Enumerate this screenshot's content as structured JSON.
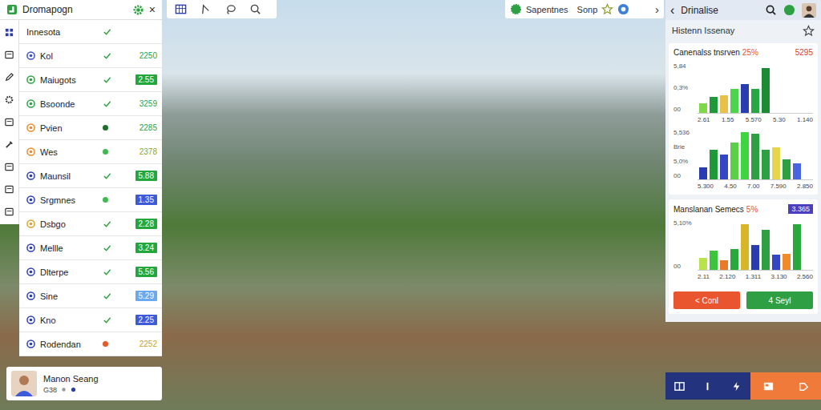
{
  "left_panel": {
    "title": "Dromapogn",
    "close": "×",
    "items": [
      {
        "name": "Innesota",
        "icon_color": null,
        "mark": "check",
        "mark_color": "#2ea043",
        "value": null,
        "value_style": "none",
        "value_color": null
      },
      {
        "name": "Kol",
        "icon_color": "#3a4fc8",
        "mark": "check",
        "mark_color": "#2ea043",
        "value": "2250",
        "value_style": "plain",
        "value_color": "#2ea043"
      },
      {
        "name": "Maiugots",
        "icon_color": "#2ea043",
        "mark": "check",
        "mark_color": "#2ea043",
        "value": "2.55",
        "value_style": "filled",
        "value_color": "#22a83a"
      },
      {
        "name": "Bsoonde",
        "icon_color": "#2ea043",
        "mark": "check",
        "mark_color": "#2ea043",
        "value": "3259",
        "value_style": "plain",
        "value_color": "#2ea043"
      },
      {
        "name": "Pvien",
        "icon_color": "#e8892a",
        "mark": "dot",
        "mark_color": "#1e6e2c",
        "value": "2285",
        "value_style": "plain",
        "value_color": "#2ea043"
      },
      {
        "name": "Wes",
        "icon_color": "#e8892a",
        "mark": "dot",
        "mark_color": "#3fb950",
        "value": "2378",
        "value_style": "plain",
        "value_color": "#8aa62a"
      },
      {
        "name": "Maunsil",
        "icon_color": "#2a3db0",
        "mark": "check",
        "mark_color": "#2ea043",
        "value": "5.88",
        "value_style": "filled",
        "value_color": "#22a83a"
      },
      {
        "name": "Srgmnes",
        "icon_color": "#2a3db0",
        "mark": "dot",
        "mark_color": "#3fb950",
        "value": "1.35",
        "value_style": "filled",
        "value_color": "#3d5bd9"
      },
      {
        "name": "Dsbgo",
        "icon_color": "#d9a12a",
        "mark": "check",
        "mark_color": "#2ea043",
        "value": "2.28",
        "value_style": "filled",
        "value_color": "#22a83a"
      },
      {
        "name": "Mellle",
        "icon_color": "#2a3db0",
        "mark": "check",
        "mark_color": "#2ea043",
        "value": "3.24",
        "value_style": "filled",
        "value_color": "#22a83a"
      },
      {
        "name": "Dlterpe",
        "icon_color": "#2a3db0",
        "mark": "check",
        "mark_color": "#2ea043",
        "value": "5.56",
        "value_style": "filled",
        "value_color": "#22a83a"
      },
      {
        "name": "Sine",
        "icon_color": "#2a3db0",
        "mark": "check",
        "mark_color": "#2ea043",
        "value": "5.29",
        "value_style": "filled",
        "value_color": "#6aa8f0"
      },
      {
        "name": "Kno",
        "icon_color": "#2a3db0",
        "mark": "check",
        "mark_color": "#2ea043",
        "value": "2.25",
        "value_style": "filled",
        "value_color": "#3d5bd9"
      },
      {
        "name": "Rodendan",
        "icon_color": "#2a3db0",
        "mark": "dot",
        "mark_color": "#e05a2a",
        "value": "2252",
        "value_style": "plain",
        "value_color": "#c9a22a"
      }
    ]
  },
  "user_card": {
    "name": "Manon Seang",
    "subtitle": "G38"
  },
  "top_toolbar_right": {
    "labels": [
      "Sapentnes",
      "Sonp"
    ],
    "chevron": "›"
  },
  "right_panel": {
    "back": "‹",
    "title": "Drinalise",
    "subtitle": "Histenn Issenay",
    "cards": [
      {
        "title": "Canenalss tnsrven",
        "percent": "25%",
        "value": "5295",
        "value_style": "plain",
        "charts": [
          {
            "ticks": [
              "5,84",
              "0,3%",
              "00"
            ],
            "max": 100,
            "bars": [
              {
                "value": 20,
                "color": "#7dd94a"
              },
              {
                "value": 33,
                "color": "#1f9a3a"
              },
              {
                "value": 36,
                "color": "#e8c14a"
              },
              {
                "value": 48,
                "color": "#4cd44a"
              },
              {
                "value": 58,
                "color": "#2a3db0"
              },
              {
                "value": 48,
                "color": "#28a745"
              },
              {
                "value": 90,
                "color": "#1d8a34"
              }
            ],
            "x_labels": [
              "2.61",
              "1.55",
              "5.570",
              "5.30",
              "1.140"
            ]
          },
          {
            "ticks": [
              "5,536",
              "Brie",
              "5,0%",
              "00"
            ],
            "max": 100,
            "bars": [
              {
                "value": 25,
                "color": "#2a3db0"
              },
              {
                "value": 60,
                "color": "#1f9a3a"
              },
              {
                "value": 50,
                "color": "#3346c4"
              },
              {
                "value": 75,
                "color": "#5ccf4a"
              },
              {
                "value": 95,
                "color": "#3ed53e"
              },
              {
                "value": 92,
                "color": "#2ea043"
              },
              {
                "value": 60,
                "color": "#2ea043"
              },
              {
                "value": 65,
                "color": "#e6d44a"
              },
              {
                "value": 40,
                "color": "#2ea043"
              },
              {
                "value": 32,
                "color": "#4a63e0"
              }
            ],
            "x_labels": [
              "5.300",
              "4.50",
              "7.00",
              "7.590",
              "2.850"
            ]
          }
        ]
      },
      {
        "title": "Manslanan Semecs",
        "percent": "5%",
        "value": "3.365",
        "value_style": "badge",
        "charts": [
          {
            "ticks": [
              "5,10%",
              "00"
            ],
            "max": 100,
            "bars": [
              {
                "value": 25,
                "color": "#b8e34a"
              },
              {
                "value": 38,
                "color": "#3dc43d"
              },
              {
                "value": 20,
                "color": "#e87a2a"
              },
              {
                "value": 42,
                "color": "#29a83c"
              },
              {
                "value": 92,
                "color": "#d9b52a"
              },
              {
                "value": 50,
                "color": "#2a3db0"
              },
              {
                "value": 80,
                "color": "#2ea043"
              },
              {
                "value": 30,
                "color": "#3346c4"
              },
              {
                "value": 32,
                "color": "#f08a2a"
              },
              {
                "value": 92,
                "color": "#2aa83c"
              }
            ],
            "x_labels": [
              "2.11",
              "2.120",
              "1.311",
              "3.130",
              "2.560"
            ]
          }
        ]
      }
    ],
    "buttons": [
      {
        "label": "< Conl",
        "color": "#e8552e"
      },
      {
        "label": "4 Seyl",
        "color": "#2ea043"
      }
    ]
  }
}
